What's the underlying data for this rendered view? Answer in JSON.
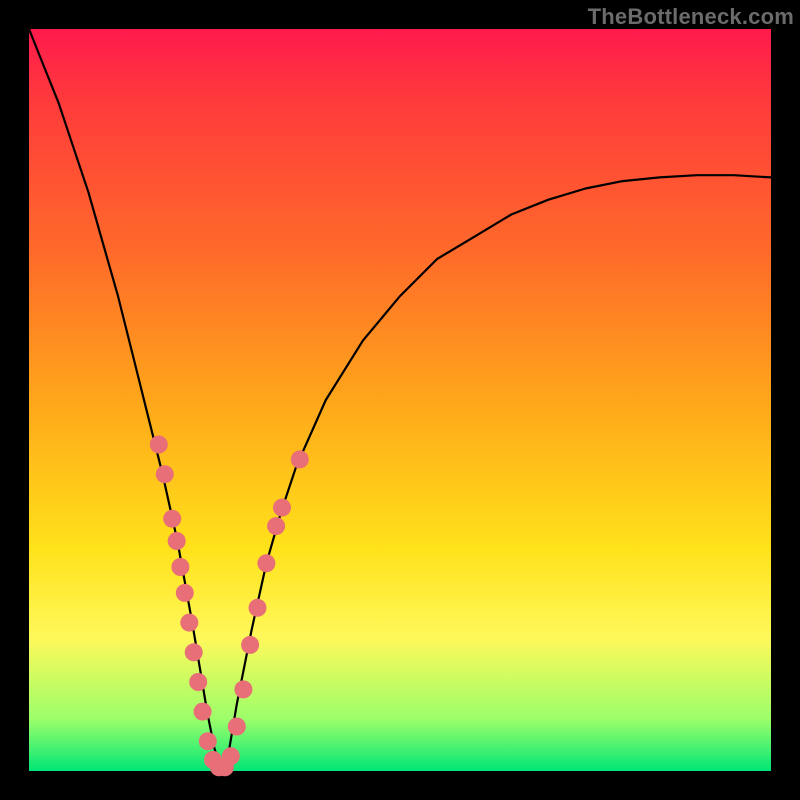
{
  "attribution": "TheBottleneck.com",
  "colors": {
    "frame": "#000000",
    "curve": "#000000",
    "marker": "#e86f77",
    "gradient_top": "#ff1a4d",
    "gradient_bottom": "#00e676"
  },
  "chart_data": {
    "type": "line",
    "title": "",
    "xlabel": "",
    "ylabel": "",
    "xlim": [
      0,
      100
    ],
    "ylim": [
      0,
      100
    ],
    "grid": false,
    "legend": false,
    "note": "No axis tick labels or gridlines are visible in the image; x/y units are therefore normalized to the 0–100 plot area. Values below are read off the plotted curve by position within the gradient square.",
    "series": [
      {
        "name": "bottleneck-curve",
        "x": [
          0,
          2,
          4,
          6,
          8,
          10,
          12,
          14,
          16,
          18,
          20,
          22,
          23,
          24,
          25,
          26,
          27,
          28,
          30,
          32,
          34,
          36,
          40,
          45,
          50,
          55,
          60,
          65,
          70,
          75,
          80,
          85,
          90,
          95,
          100
        ],
        "y": [
          100,
          95,
          90,
          84,
          78,
          71,
          64,
          56,
          48,
          40,
          31,
          20,
          14,
          8,
          3,
          0,
          3,
          9,
          19,
          28,
          35,
          41,
          50,
          58,
          64,
          69,
          72,
          75,
          77,
          78.5,
          79.5,
          80,
          80.3,
          80.3,
          80
        ]
      }
    ],
    "markers": {
      "name": "highlighted-points",
      "note": "Salmon dots clustered near the valley of the curve (left and right arms, lower ~35%).",
      "points": [
        {
          "x": 17.5,
          "y": 44
        },
        {
          "x": 18.3,
          "y": 40
        },
        {
          "x": 19.3,
          "y": 34
        },
        {
          "x": 19.9,
          "y": 31
        },
        {
          "x": 20.4,
          "y": 27.5
        },
        {
          "x": 21.0,
          "y": 24
        },
        {
          "x": 21.6,
          "y": 20
        },
        {
          "x": 22.2,
          "y": 16
        },
        {
          "x": 22.8,
          "y": 12
        },
        {
          "x": 23.4,
          "y": 8
        },
        {
          "x": 24.1,
          "y": 4
        },
        {
          "x": 24.8,
          "y": 1.5
        },
        {
          "x": 25.6,
          "y": 0.5
        },
        {
          "x": 26.4,
          "y": 0.5
        },
        {
          "x": 27.2,
          "y": 2
        },
        {
          "x": 28.0,
          "y": 6
        },
        {
          "x": 28.9,
          "y": 11
        },
        {
          "x": 29.8,
          "y": 17
        },
        {
          "x": 30.8,
          "y": 22
        },
        {
          "x": 32.0,
          "y": 28
        },
        {
          "x": 33.3,
          "y": 33
        },
        {
          "x": 34.1,
          "y": 35.5
        },
        {
          "x": 36.5,
          "y": 42
        }
      ]
    }
  }
}
